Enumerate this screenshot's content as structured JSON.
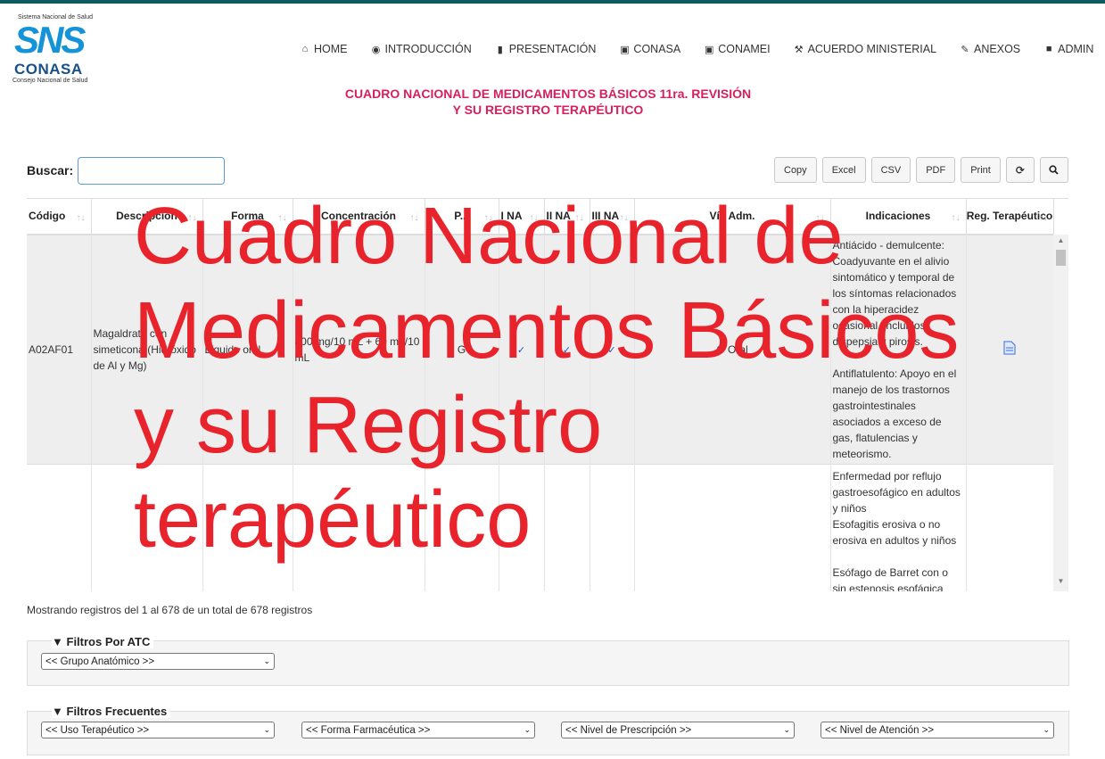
{
  "logo": {
    "top_text": "Sistema Nacional de Salud",
    "mark": "SNS",
    "name": "CONASA",
    "bottom_text": "Consejo Nacional de Salud"
  },
  "nav": [
    {
      "icon": "home-icon",
      "label": "HOME"
    },
    {
      "icon": "eye-icon",
      "label": "INTRODUCCIÓN"
    },
    {
      "icon": "bookmark-icon",
      "label": "PRESENTACIÓN"
    },
    {
      "icon": "id-card-icon",
      "label": "CONASA"
    },
    {
      "icon": "id-card-icon",
      "label": "CONAMEI"
    },
    {
      "icon": "gavel-icon",
      "label": "ACUERDO MINISTERIAL"
    },
    {
      "icon": "paperclip-icon",
      "label": "ANEXOS"
    },
    {
      "icon": "lock-icon",
      "label": "ADMIN"
    }
  ],
  "title_line1": "CUADRO NACIONAL DE MEDICAMENTOS BÁSICOS 11ra. REVISIÓN",
  "title_line2": "Y SU REGISTRO TERAPÉUTICO",
  "search": {
    "label": "Buscar:",
    "value": ""
  },
  "buttons": [
    "Copy",
    "Excel",
    "CSV",
    "PDF",
    "Print"
  ],
  "icon_buttons": [
    "refresh-icon",
    "search-icon"
  ],
  "table": {
    "headers": [
      "Código",
      "Descripción",
      "Forma",
      "Concentración",
      "P...",
      "I NA",
      "II NA",
      "III NA",
      "Vía Adm.",
      "Indicaciones",
      "Reg. Terapéutico"
    ],
    "rows": [
      {
        "codigo": "A02AF01",
        "descripcion": "Magaldrato con simeticona (Hidróxido de Al y Mg)",
        "forma": "Líquido oral",
        "concentracion": "800 mg/10 mL + 60 mg/10 mL",
        "p": "G",
        "na1": "✓",
        "na2": "✓",
        "na3": "✓",
        "via": "O Oral",
        "indicaciones": "Antiácido - demulcente: Coadyuvante en el alivio sintomático y temporal de los síntomas relacionados con la hiperacidez ocasional, incluidos dispepsia y pirosis.\n\nAntiflatulento: Apoyo en el manejo de los trastornos gastrointestinales asociados a exceso de gas, flatulencias y meteorismo."
      },
      {
        "codigo": "",
        "descripcion": "",
        "forma": "",
        "concentracion": "",
        "p": "",
        "na1": "",
        "na2": "",
        "na3": "",
        "via": "",
        "indicaciones": "Enfermedad por reflujo gastroesofágico en adultos y niños\nEsofagitis erosiva o no erosiva en adultos y niños\n\nEsófago de Barret con o sin estenosis esofágica"
      }
    ]
  },
  "info": "Mostrando registros del 1 al 678 de un total de 678 registros",
  "filters_atc": {
    "legend": "Filtros Por ATC",
    "selects": [
      "<< Grupo Anatómico >>"
    ]
  },
  "filters_freq": {
    "legend": "Filtros Frecuentes",
    "selects": [
      "<< Uso Terapéutico >>",
      "<< Forma Farmacéutica >>",
      "<< Nivel de Prescripción >>",
      "<< Nivel de Atención >>"
    ]
  },
  "overlay_text": [
    "Cuadro Nacional de",
    "Medicamentos Básicos",
    "y su Registro",
    "terapéutico"
  ],
  "colors": {
    "accent_title": "#d61f5f",
    "overlay": "#e8232b",
    "topbar": "#0f5a5e",
    "logo_blue": "#1593d8"
  }
}
